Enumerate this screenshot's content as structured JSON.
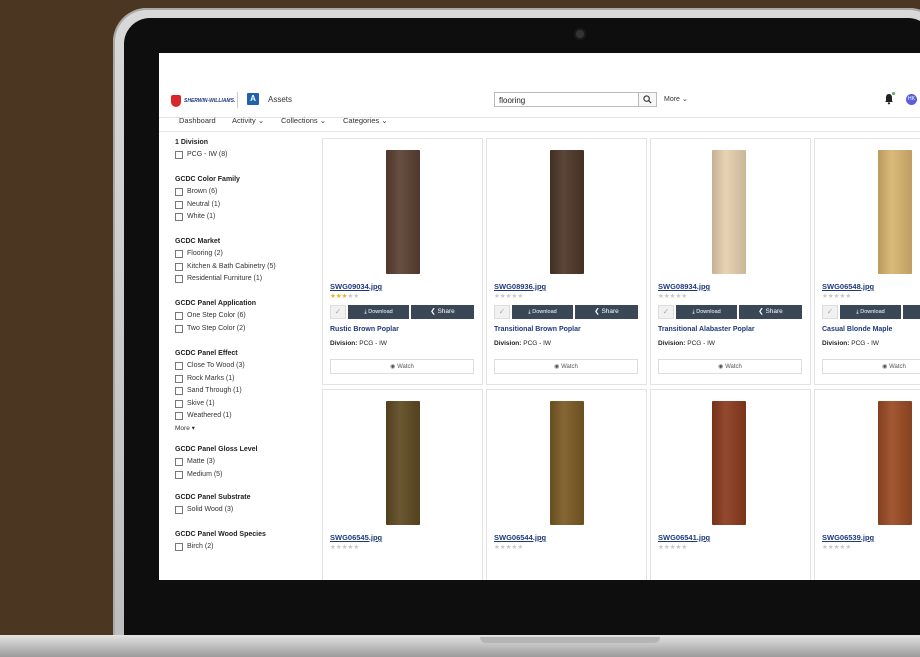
{
  "app": {
    "brand": "SHERWIN-WILLIAMS.",
    "section": "Assets",
    "search_value": "flooring",
    "more_label": "More",
    "avatar_initials": "HK",
    "accent": "#1f62b0",
    "nav_dark": "#3a4757"
  },
  "nav": {
    "dashboard": "Dashboard",
    "activity": "Activity",
    "collections": "Collections",
    "categories": "Categories"
  },
  "filters": [
    {
      "title": "1 Division",
      "options": [
        "PCG - IW (8)"
      ]
    },
    {
      "title": "GCDC Color Family",
      "options": [
        "Brown (6)",
        "Neutral (1)",
        "White (1)"
      ]
    },
    {
      "title": "GCDC Market",
      "options": [
        "Flooring (2)",
        "Kitchen & Bath Cabinetry (5)",
        "Residential Furniture (1)"
      ]
    },
    {
      "title": "GCDC Panel Application",
      "options": [
        "One Step Color (6)",
        "Two Step Color (2)"
      ]
    },
    {
      "title": "GCDC Panel Effect",
      "options": [
        "Close To Wood (3)",
        "Rock Marks (1)",
        "Sand Through (1)",
        "Skive (1)",
        "Weathered (1)"
      ],
      "more": "More"
    },
    {
      "title": "GCDC Panel Gloss Level",
      "options": [
        "Matte (3)",
        "Medium (5)"
      ]
    },
    {
      "title": "GCDC Panel Substrate",
      "options": [
        "Solid Wood (3)"
      ]
    },
    {
      "title": "GCDC Panel Wood Species",
      "options": [
        "Birch (2)"
      ]
    }
  ],
  "card_labels": {
    "download": "Download",
    "share": "Share",
    "watch": "Watch",
    "division_label": "Division:"
  },
  "assets": [
    {
      "filename": "SWG09034.jpg",
      "title": "Rustic Brown Poplar",
      "division": "PCG - IW",
      "rating": 3,
      "swatch": "#5a4031"
    },
    {
      "filename": "SWG08936.jpg",
      "title": "Transitional Brown Poplar",
      "division": "PCG - IW",
      "rating": 0,
      "swatch": "#4d3628"
    },
    {
      "filename": "SWG08934.jpg",
      "title": "Transitional Alabaster Poplar",
      "division": "PCG - IW",
      "rating": 0,
      "swatch": "#e6cfae"
    },
    {
      "filename": "SWG06548.jpg",
      "title": "Casual Blonde Maple",
      "division": "PCG - IW",
      "rating": 0,
      "swatch": "#d8b56f"
    },
    {
      "filename": "SWG06545.jpg",
      "title": "",
      "division": "",
      "rating": 0,
      "swatch": "#5e4a22"
    },
    {
      "filename": "SWG06544.jpg",
      "title": "",
      "division": "",
      "rating": 0,
      "swatch": "#7a5a22"
    },
    {
      "filename": "SWG06541.jpg",
      "title": "",
      "division": "",
      "rating": 0,
      "swatch": "#8a3a1d"
    },
    {
      "filename": "SWG06539.jpg",
      "title": "",
      "division": "",
      "rating": 0,
      "swatch": "#9a4a22"
    }
  ]
}
